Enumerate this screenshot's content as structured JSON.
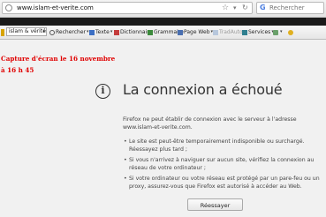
{
  "address_bar": {
    "url": "www.islam-et-verite.com",
    "star_icon": "star-icon",
    "reload_icon": "reload-icon"
  },
  "search_bar": {
    "placeholder": "Rechercher",
    "engine_icon": "google-icon"
  },
  "toolbar": {
    "combo_value": "islam & vérité",
    "items": [
      {
        "label": "Rechercher"
      },
      {
        "label": "Texte"
      },
      {
        "label": "Dictionnaire"
      },
      {
        "label": "Grammaire"
      },
      {
        "label": "Page Web"
      },
      {
        "label": "TradAuto"
      },
      {
        "label": "Services"
      }
    ]
  },
  "capture_note": {
    "line1": "Capture d'écran le 16 novembre",
    "line2": "à 16 h 45"
  },
  "error_page": {
    "title": "La connexion a échoué",
    "description": "Firefox ne peut établir de connexion avec le serveur à l'adresse www.islam-et-verite.com.",
    "bullets": [
      "Le site est peut-être temporairement indisponible ou surchargé. Réessayez plus tard ;",
      "Si vous n'arrivez à naviguer sur aucun site, vérifiez la connexion au réseau de votre ordinateur ;",
      "Si votre ordinateur ou votre réseau est protégé par un pare-feu ou un proxy, assurez-vous que Firefox est autorisé à accéder au Web."
    ],
    "retry_label": "Réessayer"
  },
  "colors": {
    "capture_text": "#e00000",
    "redaction": "#1a1a1a"
  }
}
